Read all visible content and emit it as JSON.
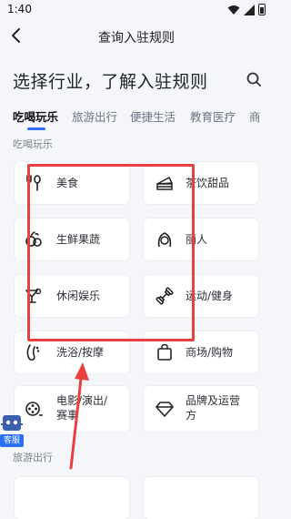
{
  "status_bar": {
    "time": "1:40"
  },
  "nav": {
    "title": "查询入驻规则"
  },
  "heading": "选择行业，了解入驻规则",
  "tabs": [
    {
      "label": "吃喝玩乐",
      "active": true
    },
    {
      "label": "旅游出行",
      "active": false
    },
    {
      "label": "便捷生活",
      "active": false
    },
    {
      "label": "教育医疗",
      "active": false
    },
    {
      "label": "商",
      "active": false
    }
  ],
  "sections": [
    {
      "label": "吃喝玩乐",
      "items": [
        {
          "label": "美食",
          "icon": "fork-spoon-icon"
        },
        {
          "label": "茶饮甜品",
          "icon": "cake-icon"
        },
        {
          "label": "生鲜果蔬",
          "icon": "fruit-icon"
        },
        {
          "label": "丽人",
          "icon": "woman-icon"
        },
        {
          "label": "休闲娱乐",
          "icon": "cocktail-icon"
        },
        {
          "label": "运动/健身",
          "icon": "dumbbell-icon"
        },
        {
          "label": "洗浴/按摩",
          "icon": "foot-icon"
        },
        {
          "label": "商场/购物",
          "icon": "shopping-bag-icon"
        },
        {
          "label": "电影/演出/赛事",
          "icon": "film-reel-icon"
        },
        {
          "label": "品牌及运营方",
          "icon": "diamond-icon"
        }
      ]
    },
    {
      "label": "旅游出行"
    }
  ],
  "service_badge": {
    "label": "客服"
  },
  "colors": {
    "accent": "#2a6ff5",
    "annotation": "#e8403f"
  }
}
